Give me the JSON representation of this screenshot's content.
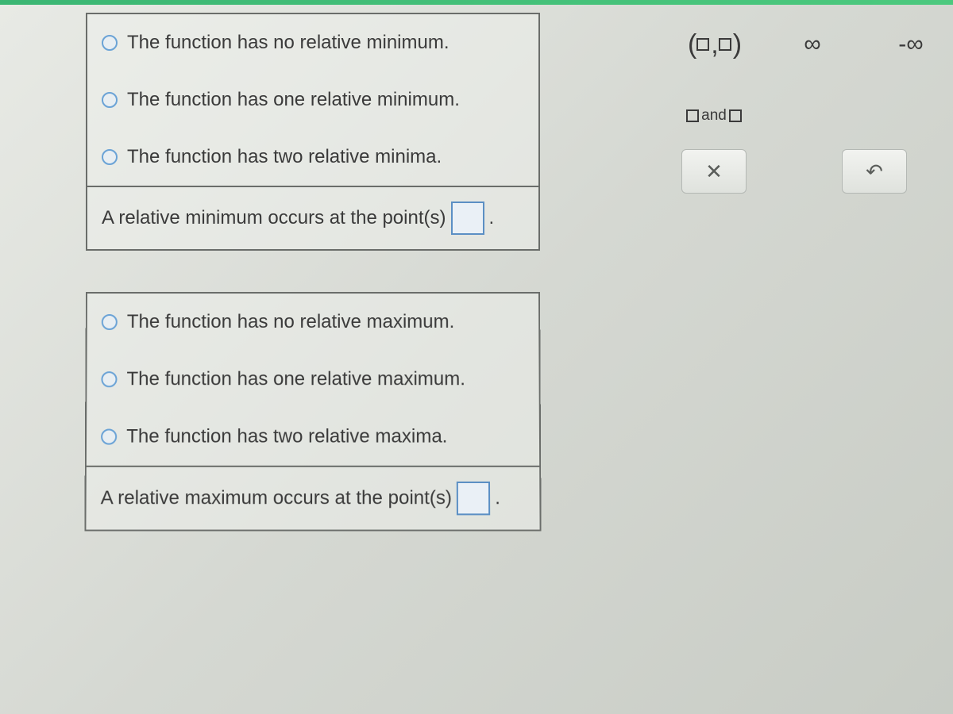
{
  "groups": {
    "minimum": {
      "options": [
        "The function has no relative minimum.",
        "The function has one relative minimum.",
        "The function has two relative minima."
      ],
      "fill_prefix": "A relative minimum occurs at the point(s)",
      "fill_suffix": "."
    },
    "maximum": {
      "options": [
        "The function has no relative maximum.",
        "The function has one relative maximum.",
        "The function has two relative maxima."
      ],
      "fill_prefix": "A relative maximum occurs at the point(s)",
      "fill_suffix": "."
    }
  },
  "palette": {
    "ordered_pair": "(□,□)",
    "infinity": "∞",
    "neg_infinity": "-∞",
    "and_middle": "and",
    "clear": "✕",
    "undo": "↶"
  }
}
